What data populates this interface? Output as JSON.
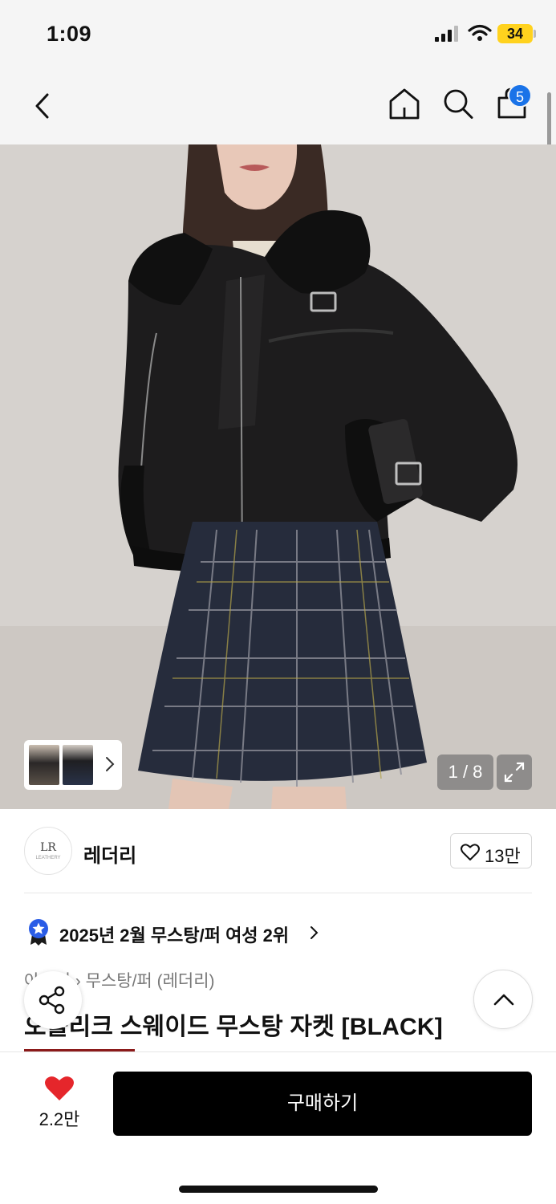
{
  "status_bar": {
    "time": "1:09",
    "battery": "34"
  },
  "nav": {
    "cart_count": "5"
  },
  "gallery": {
    "counter": "1 / 8"
  },
  "brand": {
    "name": "레더리",
    "logo_text": "LR",
    "logo_subtext": "LEATHERY",
    "likes": "13만"
  },
  "ranking": {
    "text": "2025년 2월 무스탕/퍼 여성 2위"
  },
  "product": {
    "category": "아우터 › 무스탕/퍼 (레더리)",
    "title": "오블리크 스웨이드 무스탕 자켓 [BLACK]"
  },
  "bottom_bar": {
    "wish_count": "2.2만",
    "buy_label": "구매하기"
  },
  "colors": {
    "badge": "#1a73e8",
    "heart": "#e5262b",
    "battery": "#ffd21e",
    "medal": "#2a5ce6"
  },
  "icons": [
    "back-icon",
    "home-icon",
    "search-icon",
    "shopping-bag-icon",
    "chevron-right-icon",
    "expand-icon",
    "heart-outline-icon",
    "medal-star-icon",
    "share-icon",
    "chevron-up-icon",
    "heart-filled-icon"
  ]
}
